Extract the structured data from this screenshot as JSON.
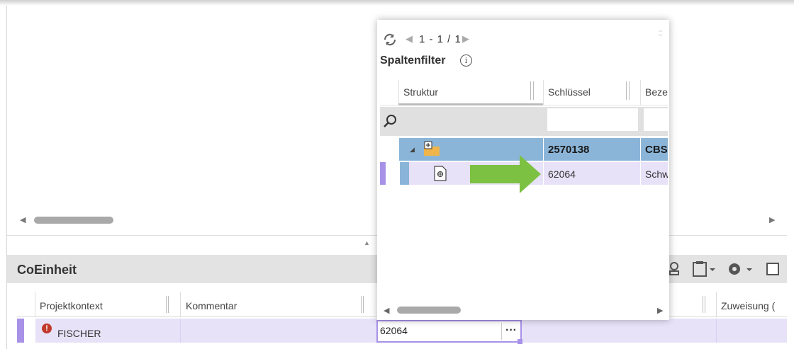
{
  "popup": {
    "pager": "1 - 1 / 1",
    "title": "Spaltenfilter",
    "columns": [
      "Struktur",
      "Schlüssel",
      "Beze"
    ],
    "rows": [
      {
        "key": "2570138",
        "desc": "CBS"
      },
      {
        "key": "62064",
        "desc": "Schw"
      }
    ]
  },
  "panel": {
    "title": "CoEinheit",
    "columns": [
      "Projektkontext",
      "Kommentar",
      "Zuweisung ("
    ],
    "row": {
      "projektkontext": "FISCHER",
      "edit_value": "62064",
      "edit_button": "···"
    }
  },
  "icons": {
    "refresh": "refresh-icon",
    "info": "info-icon",
    "search": "search-icon",
    "folder": "folder-icon",
    "document": "document-icon",
    "filter": "filter-icon",
    "clipboard": "clipboard-icon",
    "gear": "gear-icon",
    "error": "error-icon"
  },
  "colors": {
    "selection": "#8bb5d8",
    "row_highlight": "#e8e2f8",
    "accent": "#a892e8",
    "arrow": "#7cc142",
    "error": "#c0392b"
  }
}
